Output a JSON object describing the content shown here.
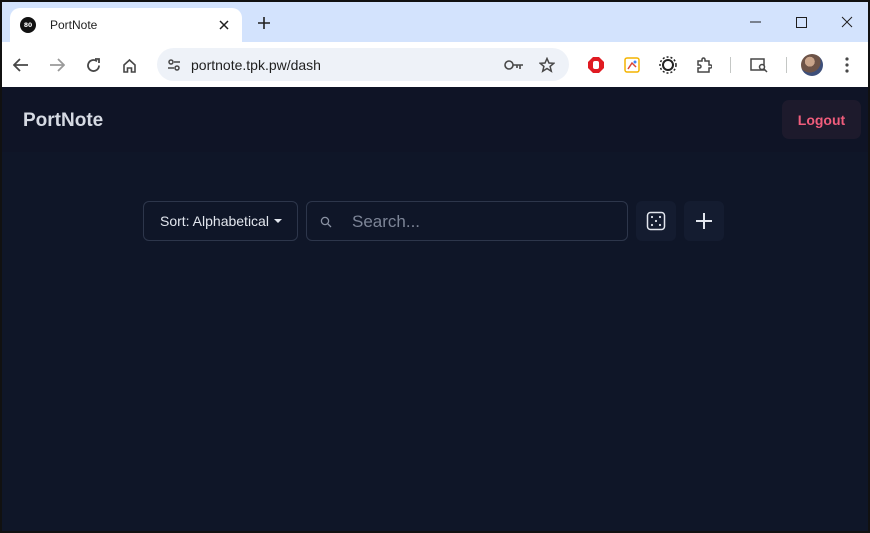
{
  "browser": {
    "tab": {
      "title": "PortNote",
      "favicon_text": "80"
    },
    "address": {
      "url": "portnote.tpk.pw/dash"
    },
    "icons": [
      "back-icon",
      "forward-icon",
      "reload-icon",
      "home-icon",
      "site-info-icon",
      "key-icon",
      "star-icon",
      "adblock-icon",
      "extension-color-icon",
      "extension-sun-icon",
      "extensions-icon",
      "tab-search-icon",
      "menu-icon"
    ]
  },
  "app": {
    "brand": "PortNote",
    "logout_label": "Logout",
    "sort_label": "Sort: Alphabetical",
    "search_placeholder": "Search...",
    "search_value": "",
    "colors": {
      "background": "#0f1628",
      "logout_text": "#f05d7c",
      "logout_bg": "#1d1a2c"
    }
  }
}
